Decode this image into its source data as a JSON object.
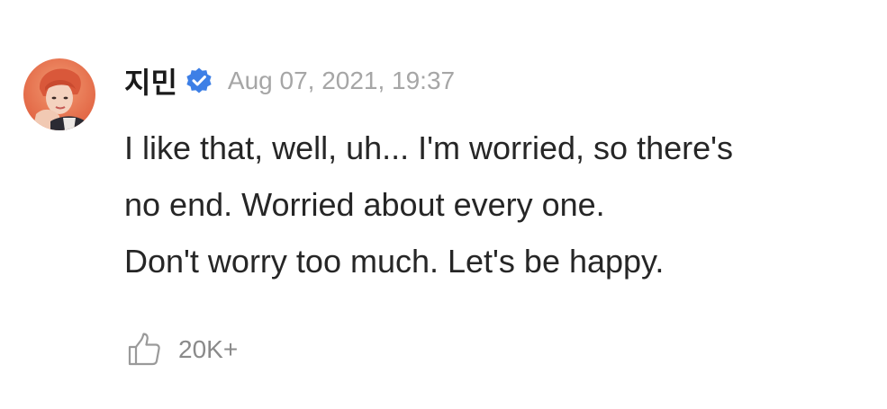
{
  "comment": {
    "author": "지민",
    "verified_icon": "verified-check-icon",
    "timestamp": "Aug 07, 2021, 19:37",
    "text_lines": [
      "I like that, well, uh... I'm worried, so there's",
      "no end. Worried about every one.",
      "Don't worry too much. Let's be happy."
    ],
    "like_icon": "thumbs-up-icon",
    "like_count": "20K+"
  },
  "colors": {
    "verified_badge": "#3d7fe6",
    "timestamp": "#a6a6a6",
    "body_text": "#262626",
    "like_count": "#8a8a8a",
    "avatar_background": "#e8734f"
  }
}
